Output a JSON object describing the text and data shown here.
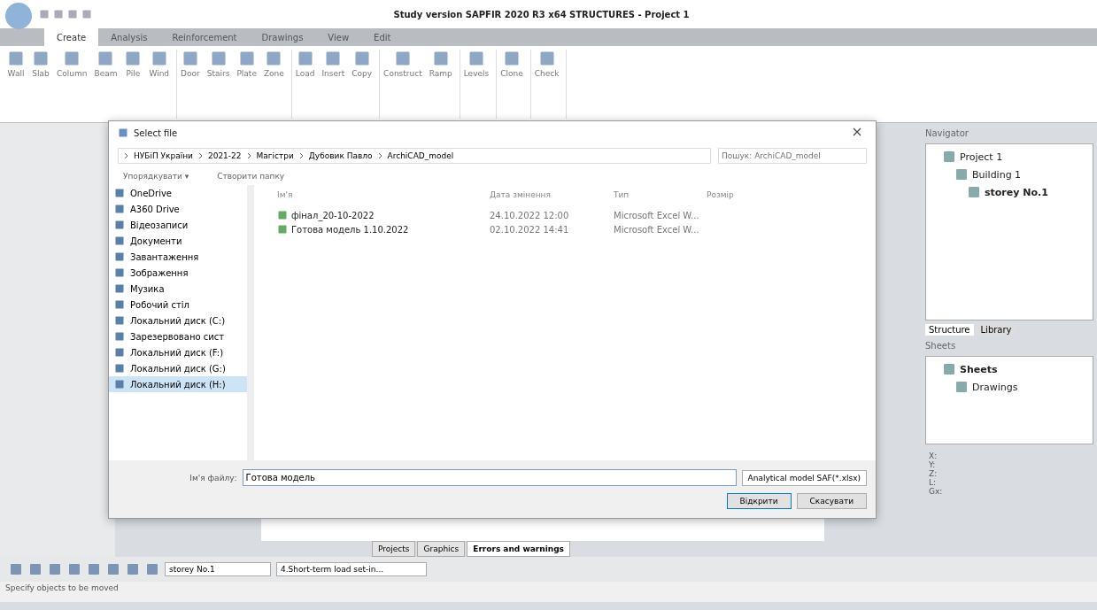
{
  "window": {
    "title": "Study version SAPFIR 2020 R3 x64 STRUCTURES - Project 1"
  },
  "ribbon": {
    "tabs": [
      {
        "label": "Create",
        "selected": true
      },
      {
        "label": "Analysis",
        "selected": false
      },
      {
        "label": "Reinforcement",
        "selected": false
      },
      {
        "label": "Drawings",
        "selected": false
      },
      {
        "label": "View",
        "selected": false
      },
      {
        "label": "Edit",
        "selected": false
      }
    ],
    "groups": [
      {
        "buttons": [
          "Wall",
          "Slab",
          "Column",
          "Beam",
          "Pile",
          "Wind"
        ]
      },
      {
        "buttons": [
          "Door",
          "Stairs",
          "Plate",
          "Zone"
        ]
      },
      {
        "buttons": [
          "Load",
          "Insert",
          "Copy"
        ]
      },
      {
        "buttons": [
          "Construct",
          "Ramp"
        ]
      },
      {
        "buttons": [
          "Levels"
        ]
      },
      {
        "buttons": [
          "Clone"
        ]
      },
      {
        "buttons": [
          "Check"
        ]
      }
    ]
  },
  "dialog": {
    "title": "Select file",
    "breadcrumb": [
      "НУБіП України",
      "2021-22",
      "Магістри",
      "Дубовик Павло",
      "ArchiCAD_model"
    ],
    "search": {
      "placeholder": "Пошук: ArchiCAD_model"
    },
    "toolbar": [
      "Упорядкувати ▾",
      "Створити папку"
    ],
    "nav": [
      {
        "label": "OneDrive",
        "selected": false
      },
      {
        "label": "A360 Drive",
        "selected": false
      },
      {
        "label": "Відеозаписи",
        "selected": false
      },
      {
        "label": "Документи",
        "selected": false
      },
      {
        "label": "Завантаження",
        "selected": false
      },
      {
        "label": "Зображення",
        "selected": false
      },
      {
        "label": "Музика",
        "selected": false
      },
      {
        "label": "Робочий стіл",
        "selected": false
      },
      {
        "label": "Локальний диск (C:)",
        "selected": false
      },
      {
        "label": "Зарезервовано сист",
        "selected": false
      },
      {
        "label": "Локальний диск (F:)",
        "selected": false
      },
      {
        "label": "Локальний диск (G:)",
        "selected": false
      },
      {
        "label": "Локальний диск (H:)",
        "selected": true
      }
    ],
    "columns": [
      "Ім'я",
      "Дата змінення",
      "Тип",
      "Розмір"
    ],
    "files": [
      {
        "name": "фінал_20-10-2022",
        "date": "24.10.2022 12:00",
        "type": "Microsoft Excel W..."
      },
      {
        "name": "Готова модель 1.10.2022",
        "date": "02.10.2022 14:41",
        "type": "Microsoft Excel W..."
      }
    ],
    "filename_label": "Ім'я файлу:",
    "filename": "Готова модель",
    "filter": "Analytical model SAF(*.xlsx)",
    "buttons": [
      "Відкрити",
      "Скасувати"
    ]
  },
  "bottom_tabs": [
    {
      "label": "Projects",
      "selected": false
    },
    {
      "label": "Graphics",
      "selected": false
    },
    {
      "label": "Errors and warnings",
      "selected": true
    }
  ],
  "storey_field": "storey No.1",
  "load_field": "4.Short-term load set-in...",
  "navigator": {
    "title": "Navigator",
    "tree": [
      {
        "label": "Project 1",
        "bold": false,
        "children": [
          {
            "label": "Building 1",
            "bold": false,
            "children": [
              {
                "label": "storey No.1",
                "bold": true
              }
            ]
          }
        ]
      }
    ]
  },
  "sheets": {
    "tabs": [
      {
        "label": "Structure",
        "selected": true
      },
      {
        "label": "Library",
        "selected": false
      }
    ],
    "title": "Sheets",
    "tree": [
      {
        "label": "Sheets",
        "bold": true,
        "children": [
          {
            "label": "Drawings",
            "bold": false
          }
        ]
      }
    ]
  },
  "coords": [
    "X:",
    "Y:",
    "Z:",
    "L:",
    "Gx:"
  ],
  "status": "Specify objects to be moved"
}
